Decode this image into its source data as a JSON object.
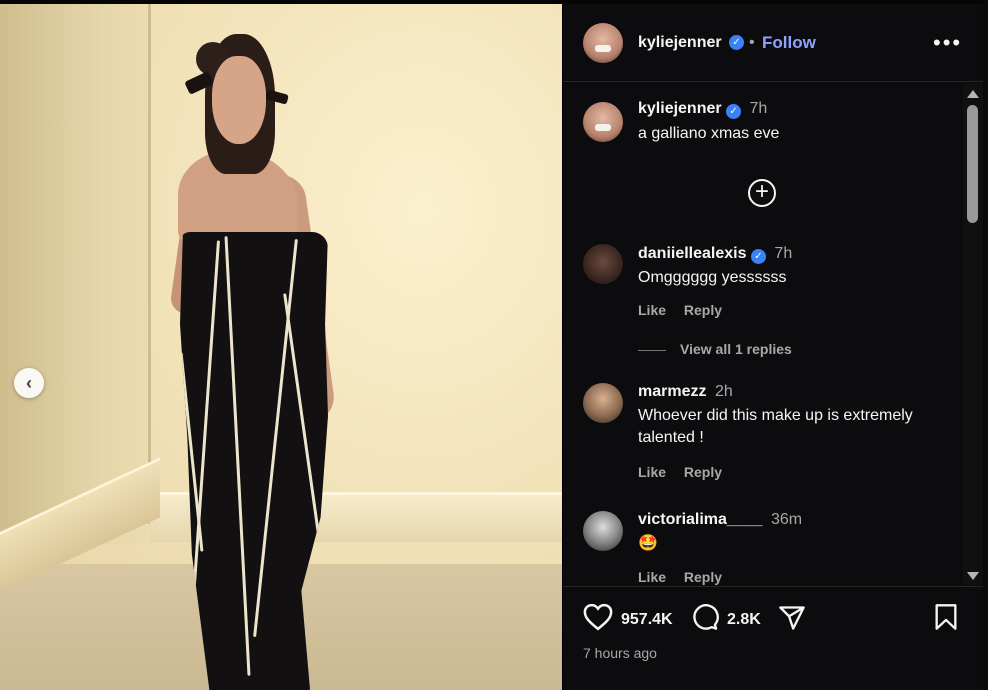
{
  "post": {
    "username": "kyliejenner",
    "follow_label": "Follow",
    "more_label": "•••",
    "dot": "•",
    "caption": {
      "username": "kyliejenner",
      "time": "7h",
      "text": "a galliano xmas eve"
    },
    "time_ago": "7 hours ago"
  },
  "comments": [
    {
      "username": "daniiellealexis",
      "time": "7h",
      "text": "Omgggggg yessssss",
      "verified": true,
      "like": "Like",
      "reply": "Reply"
    },
    {
      "username": "marmezz",
      "time": "2h",
      "text": "Whoever did this make up is extremely talented !",
      "verified": false,
      "like": "Like",
      "reply": "Reply"
    },
    {
      "username": "victorialima____",
      "time": "36m",
      "text": "🤩",
      "verified": false,
      "like": "Like",
      "reply": "Reply"
    }
  ],
  "view_replies": "View all 1 replies",
  "stats": {
    "likes": "957.4K",
    "comments": "2.8K"
  },
  "icons": {
    "prev": "chevron-left-icon",
    "add_comment": "plus-circle-icon",
    "like": "heart-icon",
    "comment": "comment-bubble-icon",
    "share": "paper-plane-icon",
    "save": "bookmark-icon"
  },
  "colors": {
    "accent": "#8fa4ff",
    "verified": "#3b82f6",
    "panel_bg": "#0c0c0f",
    "muted": "#a8a8a8"
  }
}
